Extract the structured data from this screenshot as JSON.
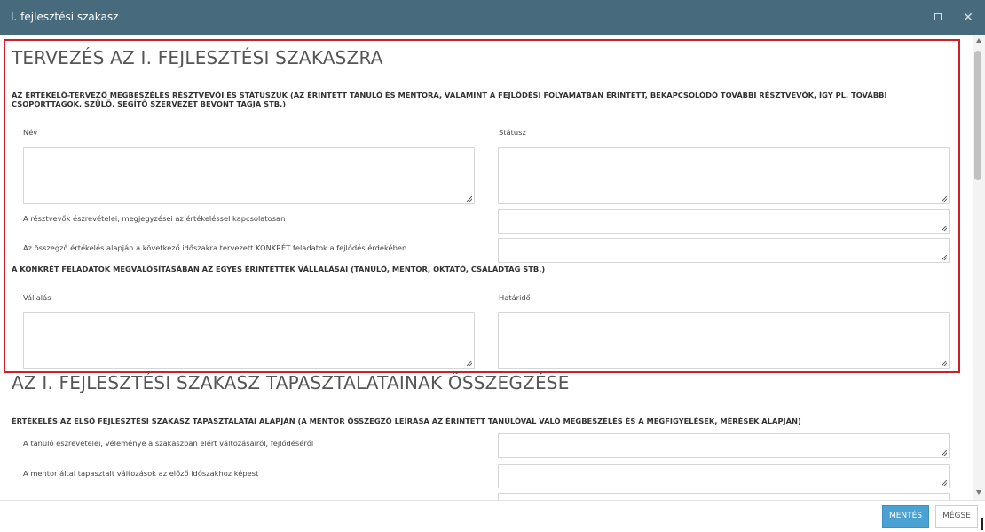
{
  "dialog": {
    "title": "I. fejlesztési szakasz"
  },
  "section1": {
    "title": "TERVEZÉS AZ I. FEJLESZTÉSI SZAKASZRA",
    "participants_heading": "AZ ÉRTÉKELŐ-TERVEZŐ MEGBESZÉLÉS RÉSZTVEVŐI ÉS STÁTUSZUK (AZ ÉRINTETT TANULÓ ÉS MENTORA, VALAMINT A FEJLŐDÉSI FOLYAMATBAN ÉRINTETT, BEKAPCSOLÓDÓ TOVÁBBI RÉSZTVEVŐK, ÍGY PL. TOVÁBBI CSOPORTTAGOK, SZÜLŐ, SEGÍTŐ SZERVEZET BEVONT TAGJA STB.)",
    "name_label": "Név",
    "status_label": "Státusz",
    "remarks_label": "A résztvevők észrevételei, megjegyzései az értékeléssel kapcsolatosan",
    "tasks_label": "Az összegző értékelés alapján a következő időszakra tervezett KONKRÉT feladatok a fejlődés érdekében",
    "commitments_heading": "A KONKRÉT FELADATOK MEGVALÓSÍTÁSÁBAN AZ EGYES ÉRINTETTEK VÁLLALÁSAI (TANULÓ, MENTOR, OKTATÓ, CSALÁDTAG STB.)",
    "commitment_label": "Vállalás",
    "deadline_label": "Határidő"
  },
  "section2": {
    "title": "AZ I. FEJLESZTÉSI SZAKASZ TAPASZTALATAINAK ÖSSZEGZÉSE",
    "evaluation_heading": "ÉRTÉKELÉS AZ ELSŐ FEJLESZTÉSI SZAKASZ TAPASZTALATAI ALAPJÁN (A MENTOR ÖSSZEGZŐ LEÍRÁSA AZ ÉRINTETT TANULÓVAL VALÓ MEGBESZÉLÉS ÉS A MEGFIGYELÉSEK, MÉRÉSEK ALAPJÁN)",
    "student_opinion_label": "A tanuló észrevételei, véleménye a szakaszban elért változásairól, fejlődéséről",
    "mentor_changes_label": "A mentor által tapasztalt változások az előző időszakhoz képest"
  },
  "footer": {
    "save_label": "MENTÉS",
    "cancel_label": "MÉGSE"
  },
  "colors": {
    "titlebar": "#476b7d",
    "highlight": "#cc1f2a",
    "primary_button": "#4aa1d3"
  }
}
